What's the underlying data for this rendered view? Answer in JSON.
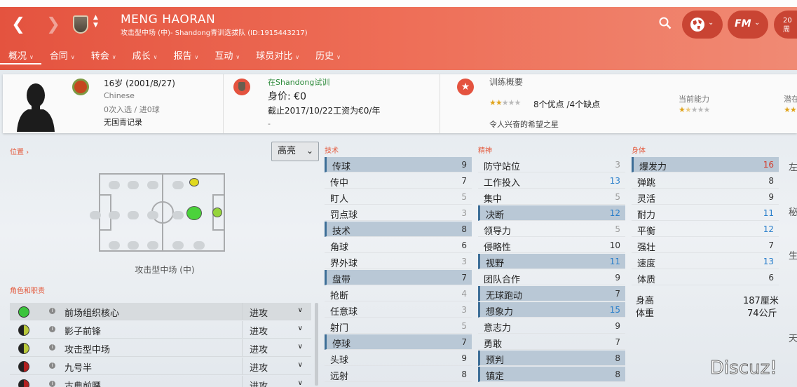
{
  "header": {
    "player_name": "MENG HAORAN",
    "subtitle": "攻击型中场 (中)- Shandong青训选拔队 (ID:1915443217)",
    "date_partial": [
      "20",
      "周"
    ],
    "fm_label": "FM"
  },
  "tabs": [
    {
      "label": "概况"
    },
    {
      "label": "合同"
    },
    {
      "label": "转会"
    },
    {
      "label": "成长"
    },
    {
      "label": "报告"
    },
    {
      "label": "互动"
    },
    {
      "label": "球员对比"
    },
    {
      "label": "历史"
    }
  ],
  "profile": {
    "age": "16岁 (2001/8/27)",
    "nationality": "Chinese",
    "caps": "0次入选 / 进0球",
    "youth_record": "无国青记录",
    "trial_prefix": "在",
    "trial_club": "Shandong",
    "trial_suffix": "试训",
    "value": "身价: €0",
    "contract": "截止2017/10/22工资为€0/年",
    "dash": "-",
    "training_title": "训练概要",
    "training_summary": "8个优点 /4个缺点",
    "training_stars": 2,
    "prospect": "令人兴奋的希望之星",
    "current_ability_label": "当前能力",
    "current_ability_stars": 1.5,
    "potential_label_partial": "潜在"
  },
  "left": {
    "position_label": "位置",
    "highlight_button": "高亮",
    "position_name": "攻击型中场 (中)",
    "roles_label": "角色和职责",
    "roles": [
      {
        "name": "前场组织核心",
        "duty": "进攻",
        "color": "#3cc43c"
      },
      {
        "name": "影子前锋",
        "duty": "进攻",
        "color": "#b9c93b"
      },
      {
        "name": "攻击型中场",
        "duty": "进攻",
        "color": "#b9c93b"
      },
      {
        "name": "九号半",
        "duty": "进攻",
        "color": "#b22020"
      },
      {
        "name": "古典前腰",
        "duty": "进攻",
        "color": "#b22020"
      }
    ]
  },
  "attributes": {
    "technical_label": "技术",
    "mental_label": "精神",
    "physical_label": "身体",
    "technical": [
      {
        "name": "传球",
        "value": 9,
        "hl": true
      },
      {
        "name": "传中",
        "value": 7
      },
      {
        "name": "盯人",
        "value": 5,
        "style": "low"
      },
      {
        "name": "罚点球",
        "value": 3,
        "style": "low"
      },
      {
        "name": "技术",
        "value": 8,
        "hl": true
      },
      {
        "name": "角球",
        "value": 6
      },
      {
        "name": "界外球",
        "value": 3,
        "style": "low"
      },
      {
        "name": "盘带",
        "value": 7,
        "hl": true
      },
      {
        "name": "抢断",
        "value": 4,
        "style": "low"
      },
      {
        "name": "任意球",
        "value": 3,
        "style": "low"
      },
      {
        "name": "射门",
        "value": 5,
        "style": "low"
      },
      {
        "name": "停球",
        "value": 7,
        "hl": true
      },
      {
        "name": "头球",
        "value": 9
      },
      {
        "name": "远射",
        "value": 8
      }
    ],
    "mental": [
      {
        "name": "防守站位",
        "value": 3,
        "style": "low"
      },
      {
        "name": "工作投入",
        "value": 13,
        "style": "blue"
      },
      {
        "name": "集中",
        "value": 5,
        "style": "low"
      },
      {
        "name": "决断",
        "value": 12,
        "style": "blue",
        "hl": true
      },
      {
        "name": "领导力",
        "value": 5,
        "style": "low"
      },
      {
        "name": "侵略性",
        "value": 10
      },
      {
        "name": "视野",
        "value": 11,
        "style": "blue",
        "hl": true
      },
      {
        "name": "团队合作",
        "value": 9
      },
      {
        "name": "无球跑动",
        "value": 7,
        "hl": true
      },
      {
        "name": "想象力",
        "value": 15,
        "style": "blue",
        "hl": true
      },
      {
        "name": "意志力",
        "value": 9
      },
      {
        "name": "勇敢",
        "value": 7
      },
      {
        "name": "预判",
        "value": 8,
        "hl": true
      },
      {
        "name": "镇定",
        "value": 8,
        "hl": true
      }
    ],
    "physical": [
      {
        "name": "爆发力",
        "value": 16,
        "style": "red",
        "hl": true
      },
      {
        "name": "弹跳",
        "value": 8
      },
      {
        "name": "灵活",
        "value": 9
      },
      {
        "name": "耐力",
        "value": 11,
        "style": "blue"
      },
      {
        "name": "平衡",
        "value": 12,
        "style": "blue"
      },
      {
        "name": "强壮",
        "value": 7
      },
      {
        "name": "速度",
        "value": 13,
        "style": "blue"
      },
      {
        "name": "体质",
        "value": 6
      }
    ],
    "height_label": "身高",
    "height": "187厘米",
    "weight_label": "体重",
    "weight": "74公斤"
  },
  "right_partial": [
    "左",
    "秘",
    "生",
    "天"
  ],
  "watermark": "Discuz!",
  "colors": {
    "header": "#e4533f",
    "accent": "#e45a3d",
    "highlight": "#b9c8d6"
  }
}
